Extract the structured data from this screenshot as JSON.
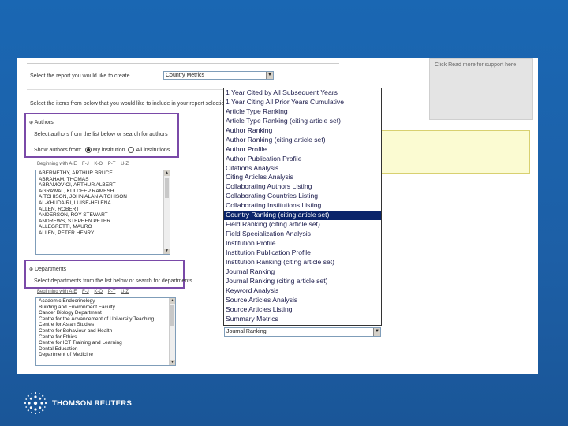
{
  "form": {
    "report_prompt": "Select the report you would like to create",
    "report_selected": "Country Metrics",
    "items_prompt": "Select the items from below that you would like to include in your report selection",
    "info_note": "Click Read more for support here"
  },
  "authors": {
    "section_label": "Authors",
    "instruction": "Select authors from the list below or search for authors",
    "show_prompt": "Show authors from:",
    "radio_my": "My institution",
    "radio_all": "All institutions",
    "alpha_nav": [
      "Beginning with A-E",
      "F-J",
      "K-O",
      "P-T",
      "U-Z"
    ],
    "items": [
      "ABERNETHY, ARTHUR BRUCE",
      "ABRAHAM, THOMAS",
      "ABRAMOVICI, ARTHUR ALBERT",
      "AGRAWAL, KULDEEP RAMESH",
      "AITCHISON, JOHN ALAN AITCHISON",
      "AL-KHUDAIRI, LUISE-HELENA",
      "ALLEN, ROBERT",
      "ANDERSON, ROY STEWART",
      "ANDREWS, STEPHEN PETER",
      "ALLEGRETTI, MAURO",
      "ALLEN, PETER HENRY"
    ]
  },
  "departments": {
    "section_label": "Departments",
    "instruction": "Select departments from the list below or search for departments",
    "alpha_nav": [
      "Beginning with A-E",
      "F-J",
      "K-O",
      "P-T",
      "U-Z"
    ],
    "items": [
      "Academic Endocrinology",
      "Building and Environment Faculty",
      "Cancer Biology Department",
      "Centre for the Advancement of University Teaching",
      "Centre for Asian Studies",
      "Centre for Behaviour and Health",
      "Centre for Ethics",
      "Centre for ICT Training and Learning",
      "Dental Education",
      "Department of Medicine"
    ]
  },
  "dropdown": {
    "options": [
      "1 Year Cited by All Subsequent Years",
      "1 Year Citing All Prior Years Cumulative",
      "Article Type Ranking",
      "Article Type Ranking (citing article set)",
      "Author Ranking",
      "Author Ranking (citing article set)",
      "Author Profile",
      "Author Publication Profile",
      "Citations Analysis",
      "Citing Articles Analysis",
      "Collaborating Authors Listing",
      "Collaborating Countries Listing",
      "Collaborating Institutions Listing",
      "Country Ranking (citing article set)",
      "Field Ranking (citing article set)",
      "Field Specialization Analysis",
      "Institution Profile",
      "Institution Publication Profile",
      "Institution Ranking (citing article set)",
      "Journal Ranking",
      "Journal Ranking (citing article set)",
      "Keyword Analysis",
      "Source Articles Analysis",
      "Source Articles Listing",
      "Summary Metrics"
    ],
    "active_index": 13,
    "collapsed_value": "Journal Ranking"
  },
  "footer": {
    "brand": "THOMSON REUTERS"
  },
  "colors": {
    "background": "#1a67b3",
    "highlight_border": "#7a4aa8",
    "callout": "#fbfbd2",
    "selected_option": "#0a246a"
  }
}
